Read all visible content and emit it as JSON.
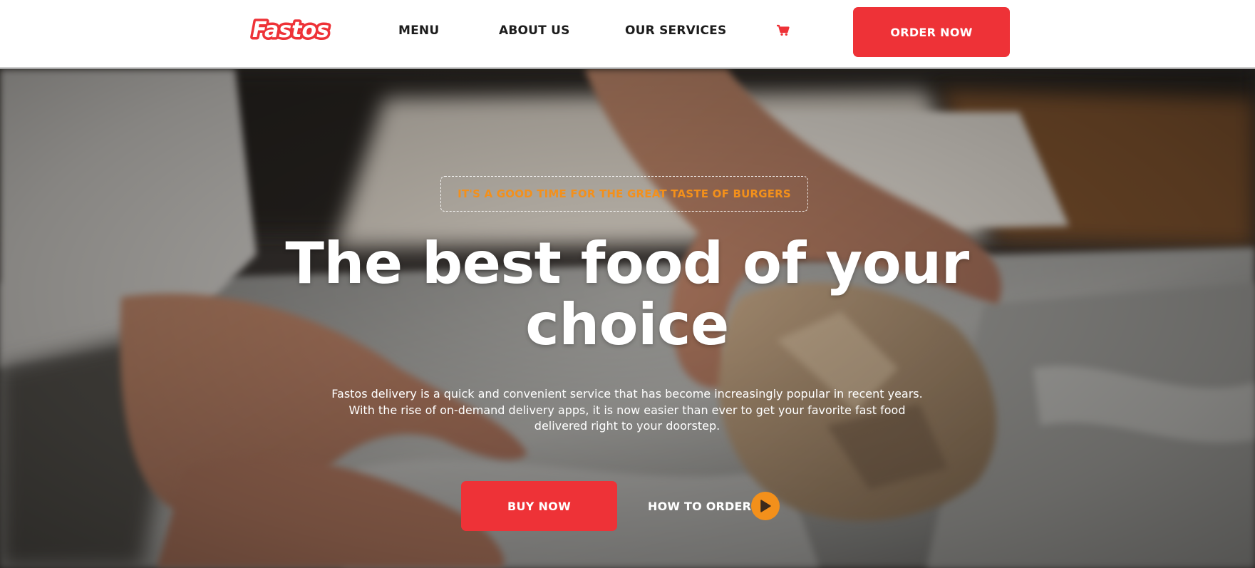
{
  "brand": {
    "logo_text": "Fastos",
    "accent_color": "#ee3237",
    "highlight_color": "#f3901b"
  },
  "nav": {
    "items": [
      {
        "label": "MENU"
      },
      {
        "label": "ABOUT US"
      },
      {
        "label": "OUR SERVICES"
      }
    ],
    "cart_icon": "shopping-cart-icon",
    "order_button": "ORDER NOW"
  },
  "hero": {
    "tagline": "IT'S A GOOD TIME FOR THE GREAT TASTE OF BURGERS",
    "headline_line1": "The best food of your",
    "headline_line2": "choice",
    "description_line1": "Fastos delivery is a quick and convenient service that has become increasingly popular in recent years.",
    "description_line2": "With the rise of on-demand delivery apps, it is now easier than ever to get your favorite fast food",
    "description_line3": "delivered right to your doorstep.",
    "buy_button": "BUY NOW",
    "how_to_order": "HOW TO ORDER",
    "play_icon": "play-icon"
  }
}
